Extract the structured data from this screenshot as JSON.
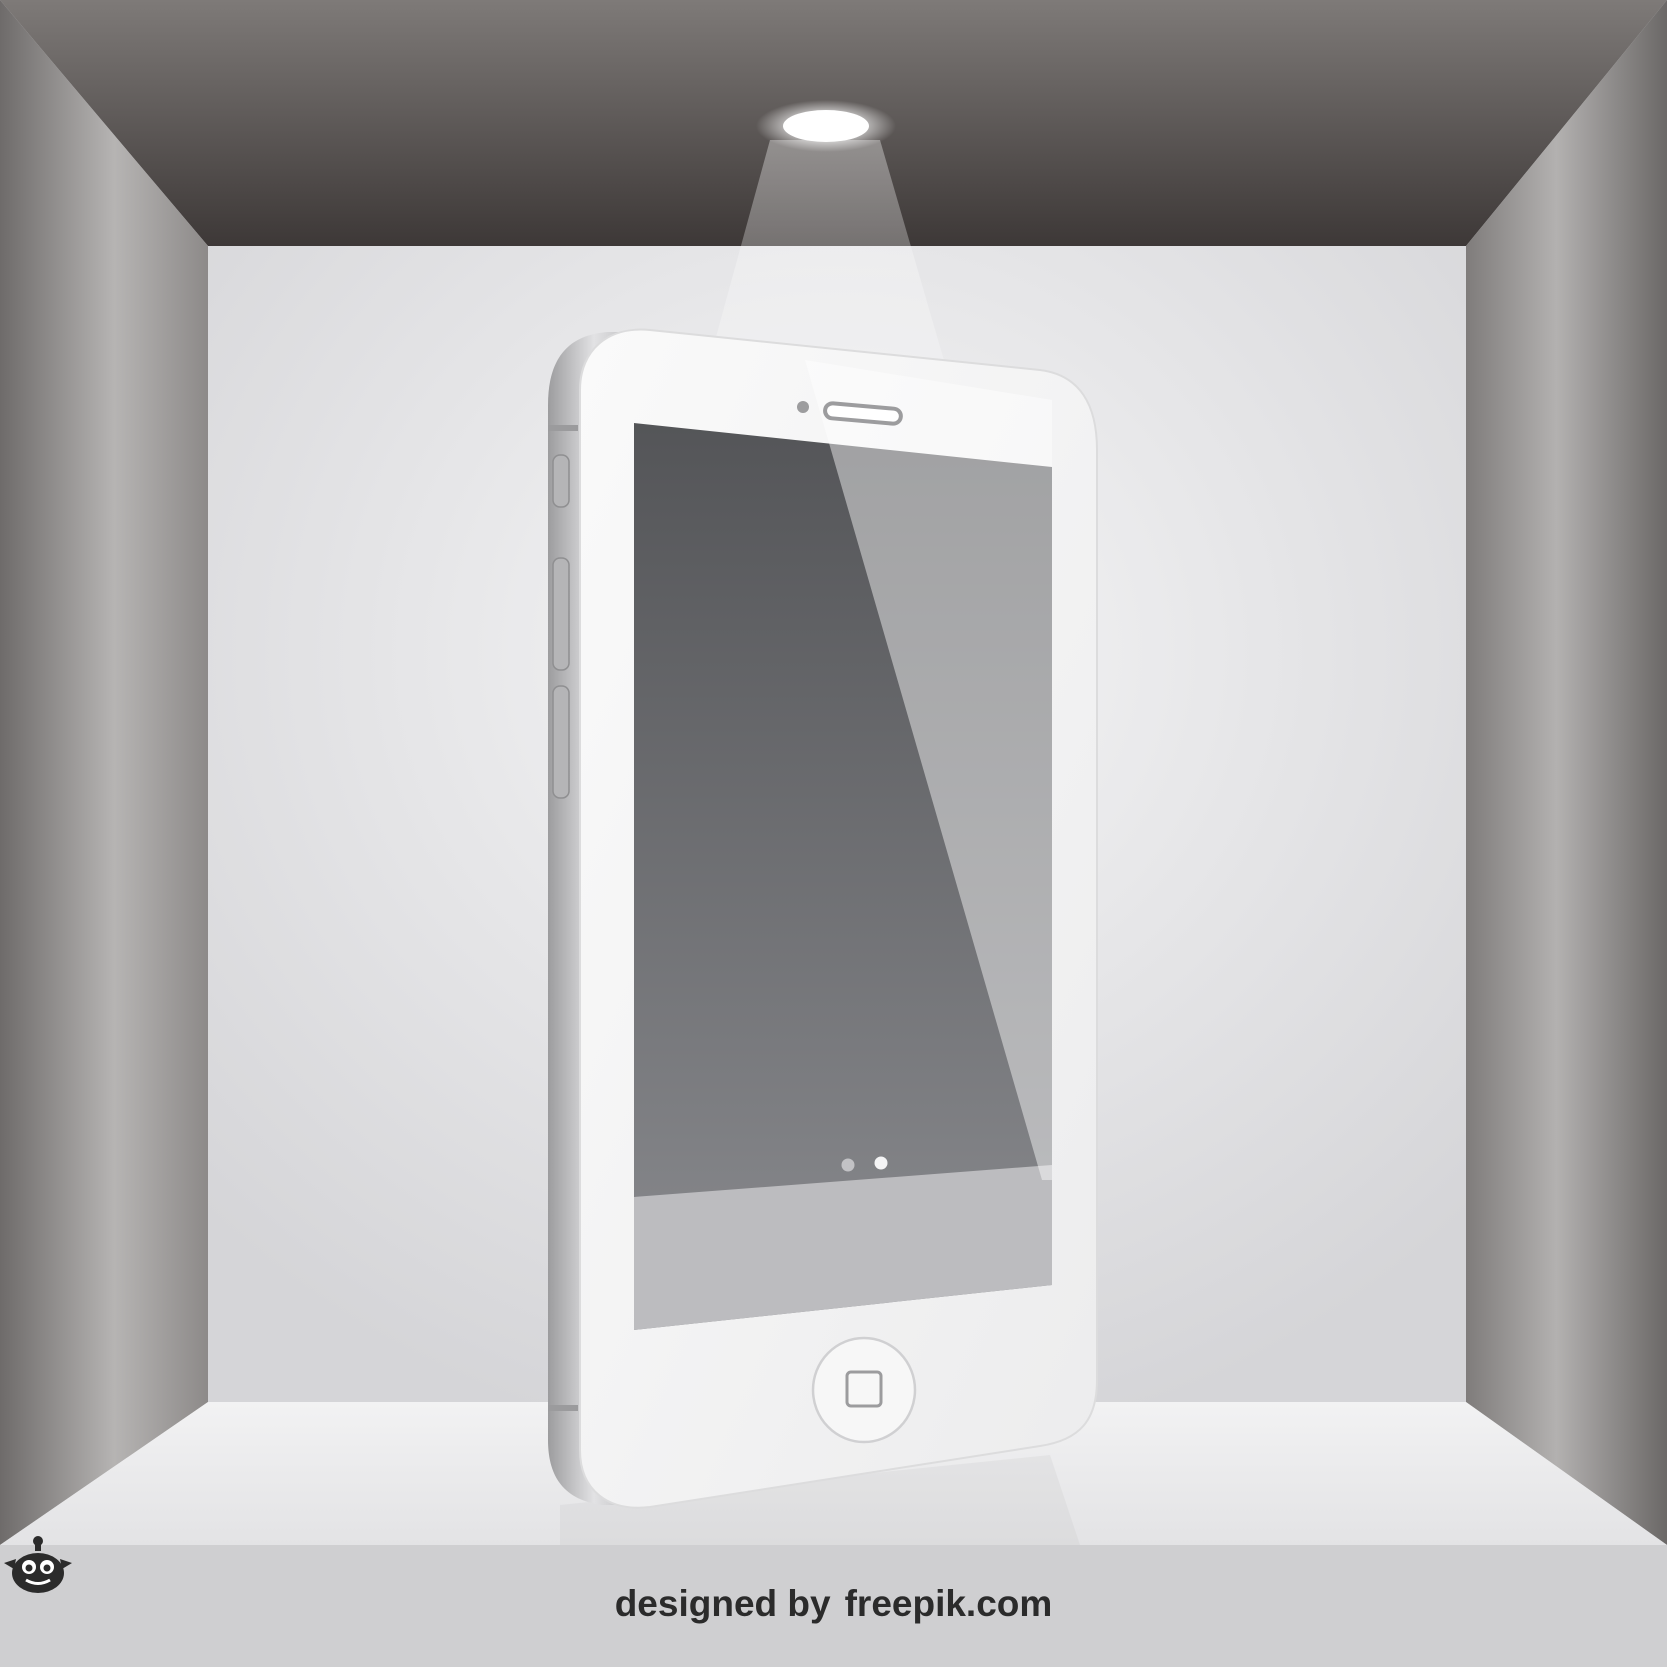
{
  "footer": {
    "designed_by": "designed by",
    "brand": "freepik.com",
    "logo_icon": "freepik-mascot-icon"
  },
  "colors": {
    "ceiling": "#5a5553",
    "side_walls": "#8f8c8b",
    "back_wall": "#e2e2e4",
    "floor": "#eeeeef",
    "phone_body": "#f4f4f4",
    "screen": "#5c5d60",
    "footer_band": "#cfcfd1"
  },
  "phone": {
    "page_dots": 2,
    "active_dot": 2
  }
}
